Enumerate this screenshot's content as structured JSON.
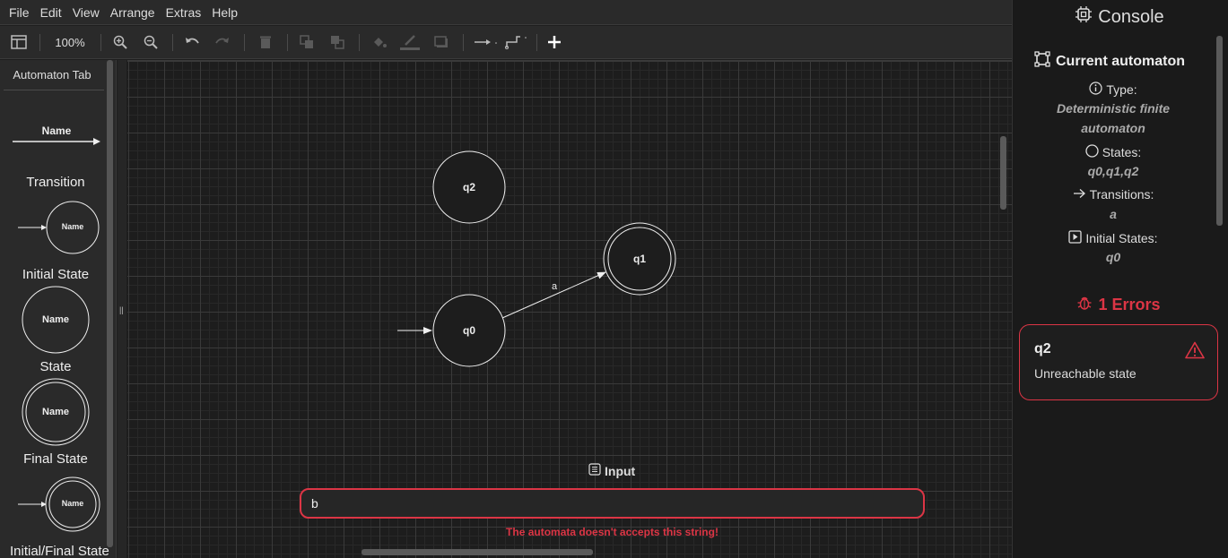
{
  "menu": [
    "File",
    "Edit",
    "View",
    "Arrange",
    "Extras",
    "Help"
  ],
  "toolbar": {
    "zoom": "100%"
  },
  "sidebar": {
    "title": "Automaton Tab",
    "transition_name": "Name",
    "labels": [
      "Transition",
      "Initial State",
      "State",
      "Final State",
      "Initial/Final State"
    ],
    "shape_name": "Name"
  },
  "graph": {
    "states": [
      {
        "id": "q2",
        "label": "q2",
        "initial": false,
        "final": false
      },
      {
        "id": "q1",
        "label": "q1",
        "initial": false,
        "final": true
      },
      {
        "id": "q0",
        "label": "q0",
        "initial": true,
        "final": false
      }
    ],
    "transitions": [
      {
        "from": "q0",
        "to": "q1",
        "label": "a"
      }
    ]
  },
  "input": {
    "title": "Input",
    "value": "b",
    "message": "The automata doesn't accepts this string!"
  },
  "console": {
    "title": "Console",
    "current_title": "Current automaton",
    "type_label": "Type:",
    "type_value": "Deterministic finite automaton",
    "states_label": "States:",
    "states_value": "q0,q1,q2",
    "transitions_label": "Transitions:",
    "transitions_value": "a",
    "initial_label": "Initial States:",
    "initial_value": "q0",
    "errors_title": "1 Errors",
    "errors": [
      {
        "state": "q2",
        "message": "Unreachable state"
      }
    ]
  },
  "colors": {
    "error": "#dc3545",
    "background": "#1e1e1e",
    "panel": "#2a2a2a"
  }
}
